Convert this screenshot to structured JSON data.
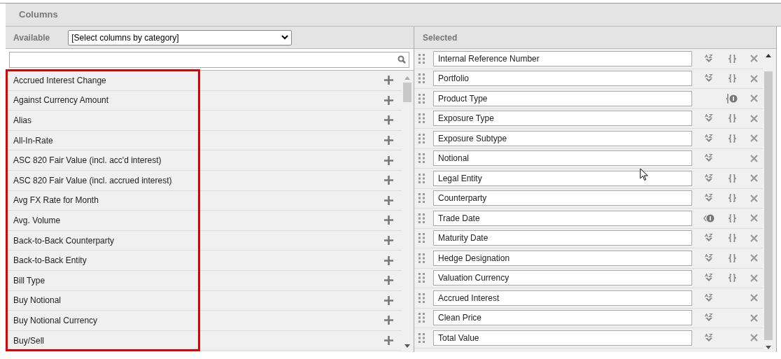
{
  "dialog": {
    "title": "Columns"
  },
  "available": {
    "label": "Available",
    "category_select": {
      "value": "[Select columns by category]"
    },
    "items": [
      "Accrued Interest Change",
      "Against Currency Amount",
      "Alias",
      "All-In-Rate",
      "ASC 820 Fair Value (incl. acc'd interest)",
      "ASC 820 Fair Value (incl. accrued interest)",
      "Avg FX Rate for Month",
      "Avg. Volume",
      "Back-to-Back Counterparty",
      "Back-to-Back Entity",
      "Bill Type",
      "Buy Notional",
      "Buy Notional Currency",
      "Buy/Sell"
    ]
  },
  "selected": {
    "label": "Selected",
    "items": [
      {
        "name": "Internal Reference Number",
        "sortable": true,
        "sort_applied": false,
        "groupable": true,
        "group_applied": false
      },
      {
        "name": "Portfolio",
        "sortable": true,
        "sort_applied": false,
        "groupable": true,
        "group_applied": false
      },
      {
        "name": "Product Type",
        "sortable": false,
        "sort_applied": false,
        "groupable": true,
        "group_applied": true
      },
      {
        "name": "Exposure Type",
        "sortable": true,
        "sort_applied": false,
        "groupable": true,
        "group_applied": false
      },
      {
        "name": "Exposure Subtype",
        "sortable": true,
        "sort_applied": false,
        "groupable": true,
        "group_applied": false
      },
      {
        "name": "Notional",
        "sortable": true,
        "sort_applied": false,
        "groupable": false,
        "group_applied": false
      },
      {
        "name": "Legal Entity",
        "sortable": true,
        "sort_applied": false,
        "groupable": true,
        "group_applied": false
      },
      {
        "name": "Counterparty",
        "sortable": true,
        "sort_applied": false,
        "groupable": true,
        "group_applied": false
      },
      {
        "name": "Trade Date",
        "sortable": true,
        "sort_applied": true,
        "groupable": true,
        "group_applied": false
      },
      {
        "name": "Maturity Date",
        "sortable": true,
        "sort_applied": false,
        "groupable": true,
        "group_applied": false
      },
      {
        "name": "Hedge Designation",
        "sortable": true,
        "sort_applied": false,
        "groupable": true,
        "group_applied": false
      },
      {
        "name": "Valuation Currency",
        "sortable": true,
        "sort_applied": false,
        "groupable": true,
        "group_applied": false
      },
      {
        "name": "Accrued Interest",
        "sortable": true,
        "sort_applied": false,
        "groupable": false,
        "group_applied": false
      },
      {
        "name": "Clean Price",
        "sortable": true,
        "sort_applied": false,
        "groupable": false,
        "group_applied": false
      },
      {
        "name": "Total Value",
        "sortable": true,
        "sort_applied": false,
        "groupable": false,
        "group_applied": false
      }
    ]
  }
}
